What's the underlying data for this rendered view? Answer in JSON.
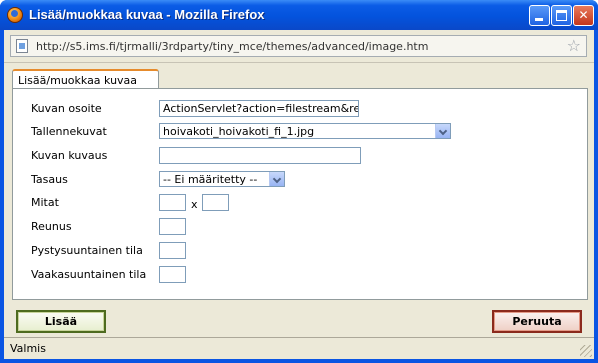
{
  "window": {
    "title": "Lisää/muokkaa kuvaa - Mozilla Firefox",
    "controls": {
      "minimize": "_",
      "maximize": "□",
      "close": "✕"
    }
  },
  "address_bar": {
    "url": "http://s5.ims.fi/tjrmalli/3rdparty/tiny_mce/themes/advanced/image.htm",
    "bookmark_icon": "star-icon",
    "page_icon": "page-icon"
  },
  "tabs": [
    {
      "label": "Lisää/muokkaa kuvaa",
      "active": true
    }
  ],
  "form": {
    "fields": {
      "image_url": {
        "label": "Kuvan osoite",
        "value": "ActionServlet?action=filestream&req"
      },
      "saved_images": {
        "label": "Tallennekuvat",
        "value": "hoivakoti_hoivakoti_fi_1.jpg"
      },
      "description": {
        "label": "Kuvan kuvaus",
        "value": ""
      },
      "alignment": {
        "label": "Tasaus",
        "value": "-- Ei määritetty --"
      },
      "dimensions": {
        "label": "Mitat",
        "width": "",
        "height": "",
        "separator": "x"
      },
      "border": {
        "label": "Reunus",
        "value": ""
      },
      "vspace": {
        "label": "Pystysuuntainen tila",
        "value": ""
      },
      "hspace": {
        "label": "Vaakasuuntainen tila",
        "value": ""
      }
    }
  },
  "buttons": {
    "insert": "Lisää",
    "cancel": "Peruuta"
  },
  "status": {
    "text": "Valmis"
  },
  "colors": {
    "titlebar": "#0453dd",
    "tab_accent": "#e68b2c",
    "insert_border": "#4e6b1f",
    "cancel_border": "#8b2a1c"
  }
}
